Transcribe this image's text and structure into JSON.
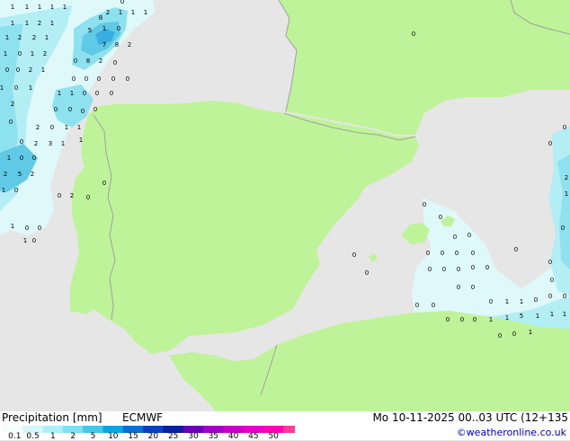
{
  "map": {
    "colors": {
      "sea": "#e6e6e6",
      "land": "#bff399",
      "border": "#a0a0a0",
      "precip_levels": [
        "#dff9fb",
        "#b4eef5",
        "#8ee1ee",
        "#5fc9e6",
        "#3aaee0"
      ]
    },
    "precip_values": [
      "1",
      "1",
      "1",
      "1",
      "1",
      "0",
      "2",
      "1",
      "1",
      "1",
      "1",
      "1",
      "2",
      "1",
      "1",
      "2",
      "2",
      "1",
      "1",
      "0",
      "1",
      "2",
      "0",
      "0",
      "2",
      "1",
      "1",
      "0",
      "1",
      "1",
      "0",
      "7",
      "8",
      "2",
      "0",
      "8",
      "2",
      "0",
      "5",
      "8",
      "0",
      "0",
      "0",
      "0",
      "0",
      "1",
      "1",
      "0",
      "0",
      "0",
      "2",
      "0",
      "0",
      "0",
      "0",
      "0",
      "2",
      "0",
      "1",
      "1",
      "1",
      "0",
      "2",
      "3",
      "1",
      "1",
      "0",
      "0",
      "2",
      "5",
      "2",
      "1",
      "0",
      "0",
      "2",
      "0",
      "0",
      "1",
      "0",
      "0",
      "1",
      "0",
      "0",
      "0",
      "0",
      "0",
      "0",
      "0",
      "0",
      "0",
      "0",
      "0",
      "0",
      "0",
      "0",
      "0",
      "0",
      "0",
      "0",
      "0",
      "0",
      "0",
      "0",
      "0",
      "0",
      "0",
      "1",
      "1",
      "0",
      "0",
      "0",
      "1",
      "1",
      "1",
      "5",
      "1",
      "1",
      "0",
      "0",
      "0",
      "0",
      "0",
      "1",
      "0",
      "0",
      "2",
      "1",
      "0",
      "0",
      "0",
      "0"
    ]
  },
  "footer": {
    "title": "Precipitation [mm]",
    "source": "ECMWF",
    "timestamp": "Mo 10-11-2025 00..03 UTC (12+135",
    "credit": "©weatheronline.co.uk"
  },
  "legend": {
    "ticks": [
      "0.1",
      "0.5",
      "1",
      "2",
      "5",
      "10",
      "15",
      "20",
      "25",
      "30",
      "35",
      "40",
      "45",
      "50"
    ],
    "colors": [
      "#f6fdfd",
      "#d6f6fa",
      "#aceef5",
      "#7ee0ee",
      "#45c8e8",
      "#0aa6e0",
      "#0a6fd2",
      "#0a3fbe",
      "#0a1f9c",
      "#6a00b4",
      "#a000c8",
      "#c800c8",
      "#e600c8",
      "#ff00b4",
      "#ff3c9c"
    ]
  }
}
